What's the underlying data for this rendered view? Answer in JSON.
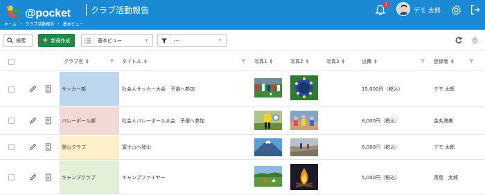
{
  "header": {
    "logo_text": "@pocket",
    "app_title": "クラブ活動報告",
    "breadcrumb": [
      "ホーム",
      "クラブ活動報告",
      "基本ビュー"
    ],
    "notification_count": "1",
    "user_name": "デモ 太郎"
  },
  "toolbar": {
    "search_label": "検索",
    "new_label": "新規作成",
    "view_value": "基本ビュー",
    "filter_value": "---"
  },
  "columns": {
    "club": "クラブ名",
    "title": "タイトル",
    "photo1": "写真1",
    "photo2": "写真2",
    "photo3": "写真3",
    "cost": "出費",
    "author": "登録者"
  },
  "rows": [
    {
      "club": "サッカー部",
      "title": "社会人サッカー大会　予選へ参加",
      "cost": "15,000円（税込）",
      "author": "デモ 太郎",
      "club_color": "#bcd6ee",
      "photo1": "soccer-match-photo",
      "photo2": "team-huddle-photo"
    },
    {
      "club": "バレーボール部",
      "title": "社会人バレーボール大会　予選へ参加",
      "cost": "8,000円（税込）",
      "author": "金丸満美",
      "club_color": "#f3d9d6",
      "photo1": "volleyball-player-photo",
      "photo2": "volleyball-team-photo"
    },
    {
      "club": "登山クラブ",
      "title": "富士山へ登山",
      "cost": "8,000円（税込）",
      "author": "デモ 太郎",
      "club_color": "#fdefc9",
      "photo1": "mount-fuji-photo",
      "photo2": "hikers-trail-photo"
    },
    {
      "club": "キャンプクラブ",
      "title": "キャンプファイヤー",
      "cost": "5,000円（税込）",
      "author": "青島　太郎",
      "club_color": "#e3f0d8",
      "photo1": "campsite-field-photo",
      "photo2": "campfire-photo"
    }
  ]
}
